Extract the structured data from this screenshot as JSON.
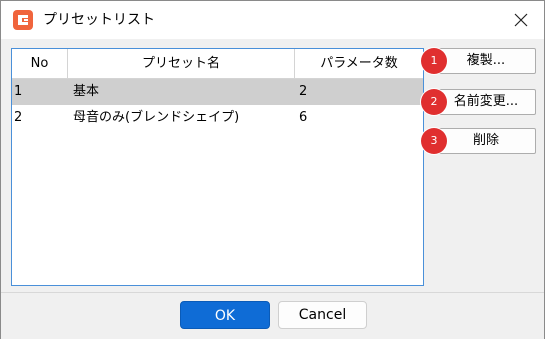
{
  "window": {
    "title": "プリセットリスト"
  },
  "table": {
    "columns": [
      "No",
      "プリセット名",
      "パラメータ数"
    ],
    "rows": [
      {
        "no": "1",
        "name": "基本",
        "params": "2"
      },
      {
        "no": "2",
        "name": "母音のみ(ブレンドシェイプ)",
        "params": "6"
      }
    ],
    "selected_row": 1
  },
  "side_buttons": {
    "duplicate": "複製...",
    "rename": "名前変更...",
    "delete": "削除"
  },
  "badges": [
    "1",
    "2",
    "3"
  ],
  "footer": {
    "ok": "OK",
    "cancel": "Cancel"
  },
  "colors": {
    "accent": "#0f6cd6",
    "badge": "#e02f2f",
    "app_icon": "#f0643c",
    "selected_row": "#cfcfcf"
  }
}
